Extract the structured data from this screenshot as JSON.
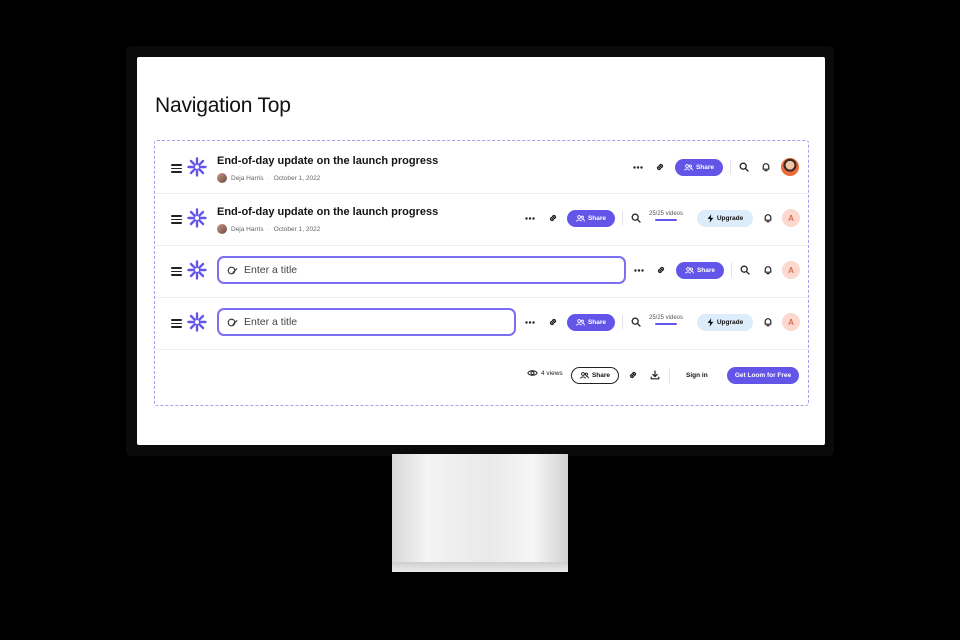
{
  "page": {
    "title": "Navigation Top"
  },
  "colors": {
    "accent": "#6355e8",
    "upgrade_bg": "#dcecfb",
    "avatar_letter_bg": "#fbd9cf",
    "input_border": "#7b6ff0"
  },
  "rows": [
    {
      "title": "End-of-day update on the launch progress",
      "author": "Deja Harris",
      "date": "October 1, 2022",
      "share_label": "Share"
    },
    {
      "title": "End-of-day update on the launch progress",
      "author": "Deja Harris",
      "date": "October 1, 2022",
      "share_label": "Share",
      "usage": "25/25 videos",
      "upgrade_label": "Upgrade",
      "avatar_letter": "A"
    },
    {
      "title_placeholder": "Enter a title",
      "share_label": "Share",
      "avatar_letter": "A"
    },
    {
      "title_placeholder": "Enter a title",
      "share_label": "Share",
      "usage": "25/25 videos",
      "upgrade_label": "Upgrade",
      "avatar_letter": "A"
    },
    {
      "views": "4 views",
      "share_label": "Share",
      "signin_label": "Sign in",
      "cta_label": "Get Loom for Free"
    }
  ],
  "usage_fraction": 1.0,
  "icons": [
    "menu-icon",
    "loom-logo-icon",
    "more-icon",
    "link-icon",
    "share-users-icon",
    "search-icon",
    "bell-icon",
    "upgrade-bolt-icon",
    "eye-icon",
    "download-icon",
    "title-edit-icon"
  ]
}
